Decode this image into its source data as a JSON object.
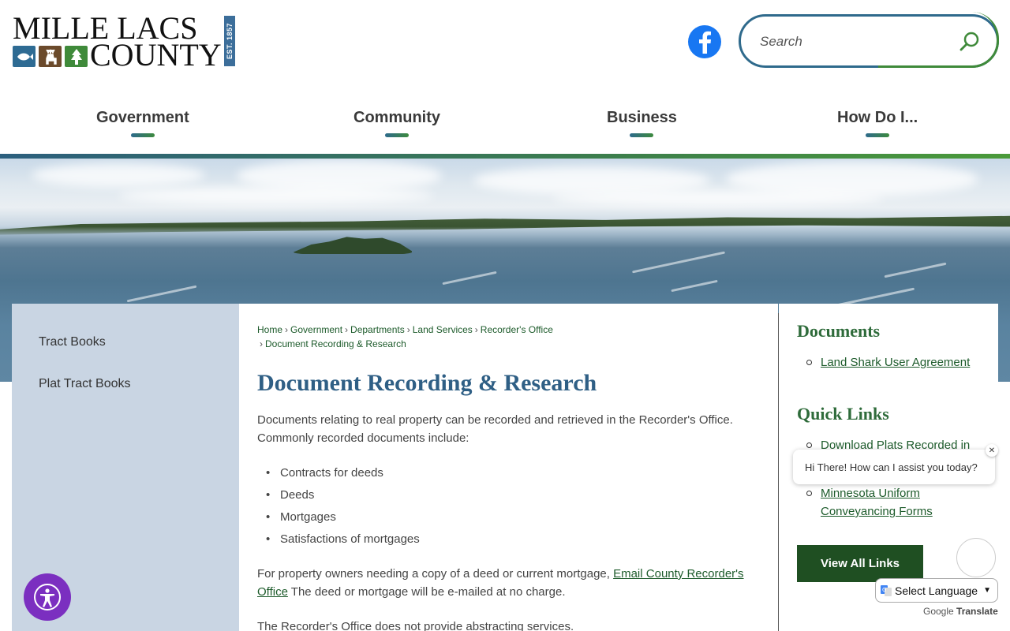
{
  "logo": {
    "line1": "MILLE LACS",
    "line2": "COUNTY",
    "est": "EST. 1857"
  },
  "search": {
    "placeholder": "Search"
  },
  "nav": {
    "items": [
      {
        "label": "Government"
      },
      {
        "label": "Community"
      },
      {
        "label": "Business"
      },
      {
        "label": "How Do I..."
      }
    ]
  },
  "sidebar": {
    "items": [
      {
        "label": "Tract Books"
      },
      {
        "label": "Plat Tract Books"
      }
    ]
  },
  "breadcrumb": {
    "items": [
      {
        "label": "Home"
      },
      {
        "label": "Government"
      },
      {
        "label": "Departments"
      },
      {
        "label": "Land Services"
      },
      {
        "label": "Recorder's Office"
      },
      {
        "label": "Document Recording & Research"
      }
    ]
  },
  "main": {
    "title": "Document Recording & Research",
    "intro": "Documents relating to real property can be recorded and retrieved in the Recorder's Office. Commonly recorded documents include:",
    "list": [
      "Contracts for deeds",
      "Deeds",
      "Mortgages",
      "Satisfactions of mortgages"
    ],
    "para2_before": "For property owners needing a copy of a deed or current mortgage, ",
    "para2_link": "Email County Recorder's Office",
    "para2_after": " The deed or mortgage will be e-mailed at no charge.",
    "para3": "The Recorder's Office does not provide abstracting services."
  },
  "right": {
    "documents_heading": "Documents",
    "documents": [
      "Land Shark User Agreement"
    ],
    "quicklinks_heading": "Quick Links",
    "quicklinks": [
      "Download Plats Recorded in",
      "Minnesota Uniform Conveyancing Forms"
    ],
    "view_all": "View All Links"
  },
  "chat": {
    "message": "Hi There! How can I assist you today?",
    "close": "✕"
  },
  "translate": {
    "label": "Select Language",
    "powered_prefix": "Google",
    "powered_suffix": "Translate"
  },
  "colors": {
    "brand_blue": "#2f5f85",
    "brand_green": "#2e6b3a",
    "sidebar_bg": "#c9d5e3",
    "button_dark_green": "#1f4f22",
    "a11y_purple": "#7b2fc0",
    "facebook_blue": "#1877f2"
  }
}
